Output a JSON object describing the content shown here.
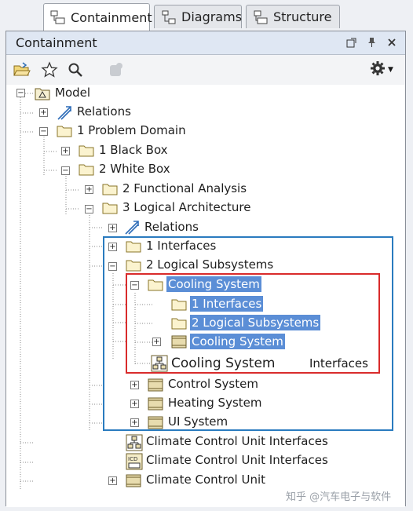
{
  "tabs": [
    {
      "label": "Containment",
      "icon": "containment-tab-icon",
      "active": true
    },
    {
      "label": "Diagrams",
      "icon": "diagrams-tab-icon",
      "active": false
    },
    {
      "label": "Structure",
      "icon": "structure-tab-icon",
      "active": false
    }
  ],
  "panel": {
    "title": "Containment"
  },
  "tree": {
    "model": "Model",
    "relations_top": "Relations",
    "problem_domain": "1 Problem Domain",
    "black_box": "1 Black Box",
    "white_box": "2 White Box",
    "functional_analysis": "2 Functional Analysis",
    "logical_architecture": "3 Logical Architecture",
    "relations_la": "Relations",
    "interfaces": "1 Interfaces",
    "logical_subsystems": "2 Logical Subsystems",
    "cooling_system_pkg": "Cooling System",
    "cs_interfaces": "1 Interfaces",
    "cs_logical_subsystems": "2 Logical Subsystems",
    "cooling_system_block": "Cooling System",
    "cooling_system_diagram": "Cooling System",
    "cooling_system_diagram_suffix": "Interfaces",
    "control_system": "Control System",
    "heating_system": "Heating System",
    "ui_system": "UI System",
    "ccu_interfaces_1": "Climate Control Unit Interfaces",
    "ccu_interfaces_2": "Climate Control Unit Interfaces",
    "ccu": "Climate Control Unit"
  },
  "watermark": "知乎 @汽车电子与软件",
  "colors": {
    "selection": "#5b8ed6",
    "blue_frame": "#2a7bbf",
    "red_frame": "#d92b2b"
  }
}
